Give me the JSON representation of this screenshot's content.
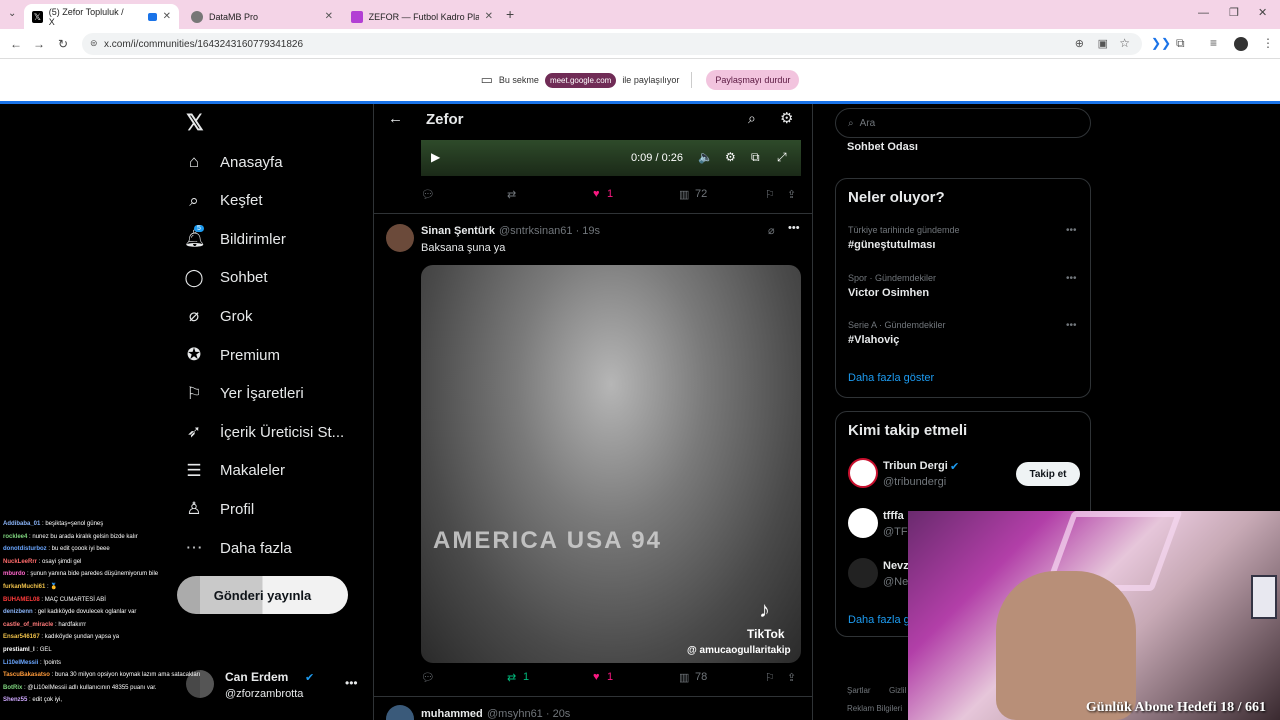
{
  "browser": {
    "tabs": [
      {
        "label": "(5) Zefor Topluluk / X",
        "active": true
      },
      {
        "label": "DataMB Pro",
        "active": false
      },
      {
        "label": "ZEFOR — Futbol Kadro Planlam...",
        "active": false
      }
    ],
    "url": "x.com/i/communities/1643243160779341826",
    "share_text": "Bu sekme",
    "share_host": "meet.google.com",
    "share_suffix": "ile paylaşılıyor",
    "stop_share": "Paylaşmayı durdur"
  },
  "nav": {
    "items": [
      {
        "label": "Anasayfa",
        "icon": "home-icon"
      },
      {
        "label": "Keşfet",
        "icon": "search-icon"
      },
      {
        "label": "Bildirimler",
        "icon": "bell-icon",
        "badge": "5"
      },
      {
        "label": "Sohbet",
        "icon": "chat-icon"
      },
      {
        "label": "Grok",
        "icon": "grok-icon"
      },
      {
        "label": "Premium",
        "icon": "premium-icon"
      },
      {
        "label": "Yer İşaretleri",
        "icon": "bookmark-icon"
      },
      {
        "label": "İçerik Üreticisi St...",
        "icon": "rocket-icon"
      },
      {
        "label": "Makaleler",
        "icon": "article-icon"
      },
      {
        "label": "Profil",
        "icon": "profile-icon"
      },
      {
        "label": "Daha fazla",
        "icon": "more-icon"
      }
    ],
    "post_button": "Gönderi yayınla",
    "account_name": "Can Erdem",
    "account_handle": "@zforzambrotta"
  },
  "center": {
    "title": "Zefor",
    "video": {
      "time": "0:09 / 0:26"
    },
    "post1_actions": {
      "likes": "1",
      "views": "72"
    },
    "post2": {
      "author": "Sinan Şentürk",
      "handle": "@sntrksinan61 · 19s",
      "text": "Baksana şuna ya",
      "watermark_brand": "TikTok",
      "watermark_user": "@ amucaogullaritakip",
      "banner_text": "AMERICA USA 94",
      "retweets": "1",
      "likes": "1",
      "views": "78"
    },
    "post3": {
      "author": "muhammed",
      "handle": "@msyhn61 · 20s"
    }
  },
  "right": {
    "search_placeholder": "Ara",
    "chat_room": "Sohbet Odası",
    "trends_title": "Neler oluyor?",
    "trends": [
      {
        "context": "Türkiye tarihinde gündemde",
        "topic": "#güneştutulması"
      },
      {
        "context": "Spor · Gündemdekiler",
        "topic": "Victor Osimhen"
      },
      {
        "context": "Serie A · Gündemdekiler",
        "topic": "#Vlahoviç"
      }
    ],
    "show_more": "Daha fazla göster",
    "follow_title": "Kimi takip etmeli",
    "follow": [
      {
        "name": "Tribun Dergi",
        "handle": "@tribundergi",
        "button": "Takip et"
      },
      {
        "name": "tfffa",
        "handle": "@TFF"
      },
      {
        "name": "Nevz",
        "handle": "@Ne"
      }
    ],
    "follow_more": "Daha fazla g",
    "footer": [
      "Şartlar",
      "Gizlil",
      "Reklam Bilgileri"
    ]
  },
  "overlay": {
    "goal_text": "Günlük Abone Hedefi 18 / 661",
    "chat": [
      {
        "user": "Addibaba_01",
        "msg": "beşiktaş=şenol güneş",
        "color": "#8ab4f8"
      },
      {
        "user": "rocklee4",
        "msg": "nunez bu arada kiralık gelsin bizde kalır",
        "color": "#7fd67f"
      },
      {
        "user": "donotdisturboz",
        "msg": "bu edit çoook iyi beee",
        "color": "#6aa6ff"
      },
      {
        "user": "NuckLeeRrr",
        "msg": "osayi şimdi gel",
        "color": "#ff6b6b"
      },
      {
        "user": "mburdo",
        "msg": "şunun yanına bide paredes düşünemiyorum bile",
        "color": "#ff66cc"
      },
      {
        "user": "furkanMuchi61",
        "msg": "🥇",
        "color": "#f0c24a"
      },
      {
        "user": "BUHAMEL08",
        "msg": "MAÇ CUMARTESİ ABİ",
        "color": "#ff3b3b"
      },
      {
        "user": "denizbenn",
        "msg": "gel kadıköyde dovulecek oglanlar var",
        "color": "#8ab4f8"
      },
      {
        "user": "castle_of_miracle",
        "msg": "hardfakırrr",
        "color": "#ff7a7a"
      },
      {
        "user": "Ensar546167",
        "msg": "kadıköyde şundan yapsa ya",
        "color": "#f0c24a"
      },
      {
        "user": "prestiamI_I",
        "msg": "GEL",
        "color": "#ffffff"
      },
      {
        "user": "Li10eIMessii",
        "msg": "!points",
        "color": "#6aa6ff"
      },
      {
        "user": "TascuBakasatso",
        "msg": "buna 30 milyon opsiyon koymak lazım ama satacakların sonu",
        "color": "#ff9b3b"
      },
      {
        "user": "BotRix",
        "msg": "@Li10eIMessii adlı kullanıcının 48355 puanı var.",
        "color": "#7fd67f"
      },
      {
        "user": "Shenz55",
        "msg": "edit çok iyi,",
        "color": "#cfa8ff"
      }
    ]
  }
}
